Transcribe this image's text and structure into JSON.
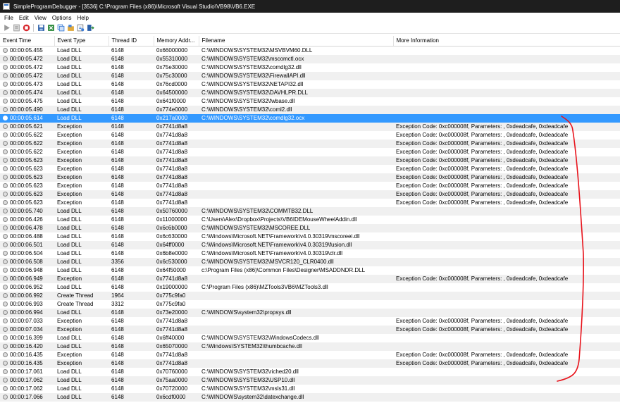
{
  "window": {
    "title": "SimpleProgramDebugger  -  [3536] C:\\Program Files (x86)\\Microsoft Visual Studio\\VB98\\VB6.EXE"
  },
  "menu": [
    "File",
    "Edit",
    "View",
    "Options",
    "Help"
  ],
  "toolbar": {
    "icons": [
      "run-icon",
      "pause-icon",
      "stop-icon",
      "save-icon",
      "export-icon",
      "copy-icon",
      "settings-icon",
      "refresh-icon",
      "exit-icon"
    ]
  },
  "columns": [
    "Event Time",
    "Event Type",
    "Thread ID",
    "Memory Addr...",
    "Filename",
    "More Information"
  ],
  "selected_index": 8,
  "annotation_color": "#e8131b",
  "rows": [
    [
      "00:00:05.455",
      "Load DLL",
      "6148",
      "0x66000000",
      "C:\\WINDOWS\\SYSTEM32\\MSVBVM60.DLL",
      ""
    ],
    [
      "00:00:05.472",
      "Load DLL",
      "6148",
      "0x55310000",
      "C:\\WINDOWS\\SYSTEM32\\mscomctl.ocx",
      ""
    ],
    [
      "00:00:05.472",
      "Load DLL",
      "6148",
      "0x75e30000",
      "C:\\WINDOWS\\SYSTEM32\\comdlg32.dll",
      ""
    ],
    [
      "00:00:05.472",
      "Load DLL",
      "6148",
      "0x75c30000",
      "C:\\WINDOWS\\SYSTEM32\\FirewallAPI.dll",
      ""
    ],
    [
      "00:00:05.473",
      "Load DLL",
      "6148",
      "0x76cd0000",
      "C:\\WINDOWS\\SYSTEM32\\NETAPI32.dll",
      ""
    ],
    [
      "00:00:05.474",
      "Load DLL",
      "6148",
      "0x64500000",
      "C:\\WINDOWS\\SYSTEM32\\DAVHLPR.DLL",
      ""
    ],
    [
      "00:00:05.475",
      "Load DLL",
      "6148",
      "0x641f0000",
      "C:\\WINDOWS\\SYSTEM32\\fwbase.dll",
      ""
    ],
    [
      "00:00:05.490",
      "Load DLL",
      "6148",
      "0x774e0000",
      "C:\\WINDOWS\\SYSTEM32\\coml2.dll",
      ""
    ],
    [
      "00:00:05.614",
      "Load DLL",
      "6148",
      "0x217a0000",
      "C:\\WINDOWS\\SYSTEM32\\comdlg32.ocx",
      ""
    ],
    [
      "00:00:05.621",
      "Exception",
      "6148",
      "0x7741d8a8",
      "",
      "Exception Code: 0xc000008f, Parameters: , 0xdeadcafe, 0xdeadcafe"
    ],
    [
      "00:00:05.622",
      "Exception",
      "6148",
      "0x7741d8a8",
      "",
      "Exception Code: 0xc000008f, Parameters: , 0xdeadcafe, 0xdeadcafe"
    ],
    [
      "00:00:05.622",
      "Exception",
      "6148",
      "0x7741d8a8",
      "",
      "Exception Code: 0xc000008f, Parameters: , 0xdeadcafe, 0xdeadcafe"
    ],
    [
      "00:00:05.622",
      "Exception",
      "6148",
      "0x7741d8a8",
      "",
      "Exception Code: 0xc000008f, Parameters: , 0xdeadcafe, 0xdeadcafe"
    ],
    [
      "00:00:05.623",
      "Exception",
      "6148",
      "0x7741d8a8",
      "",
      "Exception Code: 0xc000008f, Parameters: , 0xdeadcafe, 0xdeadcafe"
    ],
    [
      "00:00:05.623",
      "Exception",
      "6148",
      "0x7741d8a8",
      "",
      "Exception Code: 0xc000008f, Parameters: , 0xdeadcafe, 0xdeadcafe"
    ],
    [
      "00:00:05.623",
      "Exception",
      "6148",
      "0x7741d8a8",
      "",
      "Exception Code: 0xc000008f, Parameters: , 0xdeadcafe, 0xdeadcafe"
    ],
    [
      "00:00:05.623",
      "Exception",
      "6148",
      "0x7741d8a8",
      "",
      "Exception Code: 0xc000008f, Parameters: , 0xdeadcafe, 0xdeadcafe"
    ],
    [
      "00:00:05.623",
      "Exception",
      "6148",
      "0x7741d8a8",
      "",
      "Exception Code: 0xc000008f, Parameters: , 0xdeadcafe, 0xdeadcafe"
    ],
    [
      "00:00:05.623",
      "Exception",
      "6148",
      "0x7741d8a8",
      "",
      "Exception Code: 0xc000008f, Parameters: , 0xdeadcafe, 0xdeadcafe"
    ],
    [
      "00:00:05.740",
      "Load DLL",
      "6148",
      "0x50760000",
      "C:\\WINDOWS\\SYSTEM32\\COMMTB32.DLL",
      ""
    ],
    [
      "00:00:06.426",
      "Load DLL",
      "6148",
      "0x11000000",
      "C:\\Users\\Alex\\Dropbox\\Projects\\VB6IDEMouseWheelAddin.dll",
      ""
    ],
    [
      "00:00:06.478",
      "Load DLL",
      "6148",
      "0x6c6b0000",
      "C:\\WINDOWS\\SYSTEM32\\MSCOREE.DLL",
      ""
    ],
    [
      "00:00:06.488",
      "Load DLL",
      "6148",
      "0x6c630000",
      "C:\\Windows\\Microsoft.NET\\Framework\\v4.0.30319\\mscoreei.dll",
      ""
    ],
    [
      "00:00:06.501",
      "Load DLL",
      "6148",
      "0x64ff0000",
      "C:\\Windows\\Microsoft.NET\\Framework\\v4.0.30319\\fusion.dll",
      ""
    ],
    [
      "00:00:06.504",
      "Load DLL",
      "6148",
      "0x6b8e0000",
      "C:\\Windows\\Microsoft.NET\\Framework\\v4.0.30319\\clr.dll",
      ""
    ],
    [
      "00:00:06.508",
      "Load DLL",
      "3356",
      "0x6c530000",
      "C:\\WINDOWS\\SYSTEM32\\MSVCR120_CLR0400.dll",
      ""
    ],
    [
      "00:00:06.948",
      "Load DLL",
      "6148",
      "0x64f50000",
      "c:\\Program Files (x86)\\Common Files\\Designer\\MSADDNDR.DLL",
      ""
    ],
    [
      "00:00:06.949",
      "Exception",
      "6148",
      "0x7741d8a8",
      "",
      "Exception Code: 0xc000008f, Parameters: , 0xdeadcafe, 0xdeadcafe"
    ],
    [
      "00:00:06.952",
      "Load DLL",
      "6148",
      "0x19000000",
      "C:\\Program Files (x86)\\MZTools3VB6\\MZTools3.dll",
      ""
    ],
    [
      "00:00:06.992",
      "Create Thread",
      "1964",
      "0x775c9fa0",
      "",
      ""
    ],
    [
      "00:00:06.993",
      "Create Thread",
      "3312",
      "0x775c9fa0",
      "",
      ""
    ],
    [
      "00:00:06.994",
      "Load DLL",
      "6148",
      "0x73e20000",
      "C:\\WINDOWS\\system32\\propsys.dll",
      ""
    ],
    [
      "00:00:07.033",
      "Exception",
      "6148",
      "0x7741d8a8",
      "",
      "Exception Code: 0xc000008f, Parameters: , 0xdeadcafe, 0xdeadcafe"
    ],
    [
      "00:00:07.034",
      "Exception",
      "6148",
      "0x7741d8a8",
      "",
      "Exception Code: 0xc000008f, Parameters: , 0xdeadcafe, 0xdeadcafe"
    ],
    [
      "00:00:16.399",
      "Load DLL",
      "6148",
      "0x6ff40000",
      "C:\\WINDOWS\\SYSTEM32\\WindowsCodecs.dll",
      ""
    ],
    [
      "00:00:16.420",
      "Load DLL",
      "6148",
      "0x65070000",
      "C:\\Windows\\SYSTEM32\\thumbcache.dll",
      ""
    ],
    [
      "00:00:16.435",
      "Exception",
      "6148",
      "0x7741d8a8",
      "",
      "Exception Code: 0xc000008f, Parameters: , 0xdeadcafe, 0xdeadcafe"
    ],
    [
      "00:00:16.435",
      "Exception",
      "6148",
      "0x7741d8a8",
      "",
      "Exception Code: 0xc000008f, Parameters: , 0xdeadcafe, 0xdeadcafe"
    ],
    [
      "00:00:17.061",
      "Load DLL",
      "6148",
      "0x70760000",
      "C:\\WINDOWS\\SYSTEM32\\riched20.dll",
      ""
    ],
    [
      "00:00:17.062",
      "Load DLL",
      "6148",
      "0x75aa0000",
      "C:\\WINDOWS\\SYSTEM32\\USP10.dll",
      ""
    ],
    [
      "00:00:17.062",
      "Load DLL",
      "6148",
      "0x70720000",
      "C:\\WINDOWS\\SYSTEM32\\msls31.dll",
      ""
    ],
    [
      "00:00:17.066",
      "Load DLL",
      "6148",
      "0x6cdf0000",
      "C:\\WINDOWS\\system32\\datexchange.dll",
      ""
    ]
  ]
}
